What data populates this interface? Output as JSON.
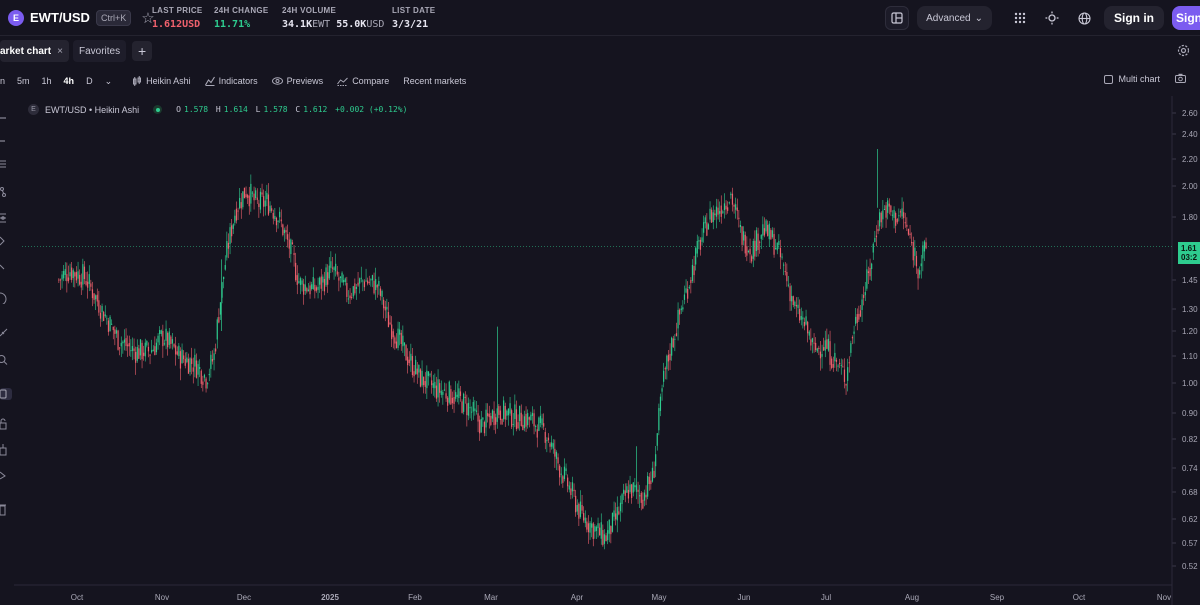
{
  "header": {
    "pair": "EWT/USD",
    "pair_logo": "E",
    "shortcut": "Ctrl+K",
    "stats": [
      {
        "label": "LAST PRICE",
        "value": "1.612",
        "unit": "USD",
        "tone": "red"
      },
      {
        "label": "24H CHANGE",
        "value": "11.71%",
        "unit": "",
        "tone": "green"
      },
      {
        "label": "24H VOLUME",
        "value": "34.1K",
        "unit": "EWT",
        "value2": "55.0K",
        "unit2": "USD",
        "tone": "normal"
      },
      {
        "label": "LIST DATE",
        "value": "3/3/21",
        "unit": "",
        "tone": "normal"
      }
    ],
    "advanced_label": "Advanced",
    "signin_label": "Sign in",
    "signup_label": "Sign up"
  },
  "tabs": {
    "active": "arket chart",
    "favorites": "Favorites"
  },
  "toolbar": {
    "timeframes": [
      "n",
      "5m",
      "1h",
      "4h",
      "D"
    ],
    "active_timeframe": "4h",
    "items": [
      "Heikin Ashi",
      "Indicators",
      "Previews",
      "Compare",
      "Recent markets"
    ],
    "multi_chart": "Multi chart"
  },
  "legend": {
    "symbol": "EWT/USD • Heikin Ashi",
    "icon_letter": "E",
    "o_label": "O",
    "o": "1.578",
    "h_label": "H",
    "h": "1.614",
    "l_label": "L",
    "l": "1.578",
    "c_label": "C",
    "c": "1.612",
    "change": "+0.002 (+0.12%)"
  },
  "price_tag": {
    "line1": "1.61",
    "line2": "03:2"
  },
  "colors": {
    "up": "#2ecc8f",
    "down": "#f0616d",
    "accent": "#7b5cf0",
    "bg": "#15141f"
  },
  "chart_data": {
    "type": "candlestick",
    "style": "Heikin Ashi",
    "y_ticks": [
      "2.60",
      "2.40",
      "2.20",
      "2.00",
      "1.80",
      "1.61",
      "1.45",
      "1.30",
      "1.20",
      "1.10",
      "1.00",
      "0.90",
      "0.82",
      "0.74",
      "0.68",
      "0.62",
      "0.57",
      "0.52"
    ],
    "x_ticks": [
      "Oct",
      "Nov",
      "Dec",
      "2025",
      "Feb",
      "Mar",
      "Apr",
      "May",
      "Jun",
      "Jul",
      "Aug",
      "Sep",
      "Oct",
      "Nov"
    ],
    "last_price": 1.612,
    "grid": false,
    "series_path": [
      [
        "2024-09-24",
        1.45
      ],
      [
        "2024-09-28",
        1.5
      ],
      [
        "2024-10-04",
        1.46
      ],
      [
        "2024-10-10",
        1.3
      ],
      [
        "2024-10-16",
        1.17
      ],
      [
        "2024-10-22",
        1.12
      ],
      [
        "2024-10-28",
        1.12
      ],
      [
        "2024-11-02",
        1.18
      ],
      [
        "2024-11-08",
        1.1
      ],
      [
        "2024-11-14",
        1.07
      ],
      [
        "2024-11-18",
        1.02
      ],
      [
        "2024-11-21",
        1.1
      ],
      [
        "2024-11-25",
        1.52
      ],
      [
        "2024-11-29",
        1.85
      ],
      [
        "2024-12-03",
        1.98
      ],
      [
        "2024-12-07",
        1.88
      ],
      [
        "2024-12-11",
        1.9
      ],
      [
        "2024-12-15",
        1.8
      ],
      [
        "2024-12-19",
        1.62
      ],
      [
        "2024-12-23",
        1.43
      ],
      [
        "2024-12-29",
        1.4
      ],
      [
        "2025-01-04",
        1.5
      ],
      [
        "2025-01-10",
        1.38
      ],
      [
        "2025-01-16",
        1.45
      ],
      [
        "2025-01-21",
        1.42
      ],
      [
        "2025-01-25",
        1.25
      ],
      [
        "2025-01-31",
        1.12
      ],
      [
        "2025-02-06",
        1.02
      ],
      [
        "2025-02-12",
        0.98
      ],
      [
        "2025-02-18",
        0.96
      ],
      [
        "2025-02-24",
        0.92
      ],
      [
        "2025-03-01",
        0.86
      ],
      [
        "2025-03-07",
        0.91
      ],
      [
        "2025-03-13",
        0.89
      ],
      [
        "2025-03-19",
        0.88
      ],
      [
        "2025-03-25",
        0.84
      ],
      [
        "2025-03-29",
        0.76
      ],
      [
        "2025-04-02",
        0.7
      ],
      [
        "2025-04-07",
        0.63
      ],
      [
        "2025-04-12",
        0.6
      ],
      [
        "2025-04-16",
        0.58
      ],
      [
        "2025-04-20",
        0.62
      ],
      [
        "2025-04-25",
        0.69
      ],
      [
        "2025-04-30",
        0.67
      ],
      [
        "2025-05-04",
        0.72
      ],
      [
        "2025-05-08",
        1.02
      ],
      [
        "2025-05-14",
        1.28
      ],
      [
        "2025-05-19",
        1.52
      ],
      [
        "2025-05-25",
        1.8
      ],
      [
        "2025-05-29",
        1.86
      ],
      [
        "2025-06-02",
        1.95
      ],
      [
        "2025-06-06",
        1.68
      ],
      [
        "2025-06-10",
        1.6
      ],
      [
        "2025-06-14",
        1.73
      ],
      [
        "2025-06-18",
        1.65
      ],
      [
        "2025-06-22",
        1.5
      ],
      [
        "2025-06-26",
        1.3
      ],
      [
        "2025-06-30",
        1.22
      ],
      [
        "2025-07-03",
        1.12
      ],
      [
        "2025-07-07",
        1.15
      ],
      [
        "2025-07-11",
        1.08
      ],
      [
        "2025-07-15",
        1.02
      ],
      [
        "2025-07-18",
        1.22
      ],
      [
        "2025-07-21",
        1.35
      ],
      [
        "2025-07-24",
        1.5
      ],
      [
        "2025-07-27",
        1.78
      ],
      [
        "2025-07-30",
        1.86
      ],
      [
        "2025-08-02",
        1.8
      ],
      [
        "2025-08-05",
        1.82
      ],
      [
        "2025-08-08",
        1.65
      ],
      [
        "2025-08-11",
        1.52
      ],
      [
        "2025-08-14",
        1.6
      ]
    ]
  }
}
